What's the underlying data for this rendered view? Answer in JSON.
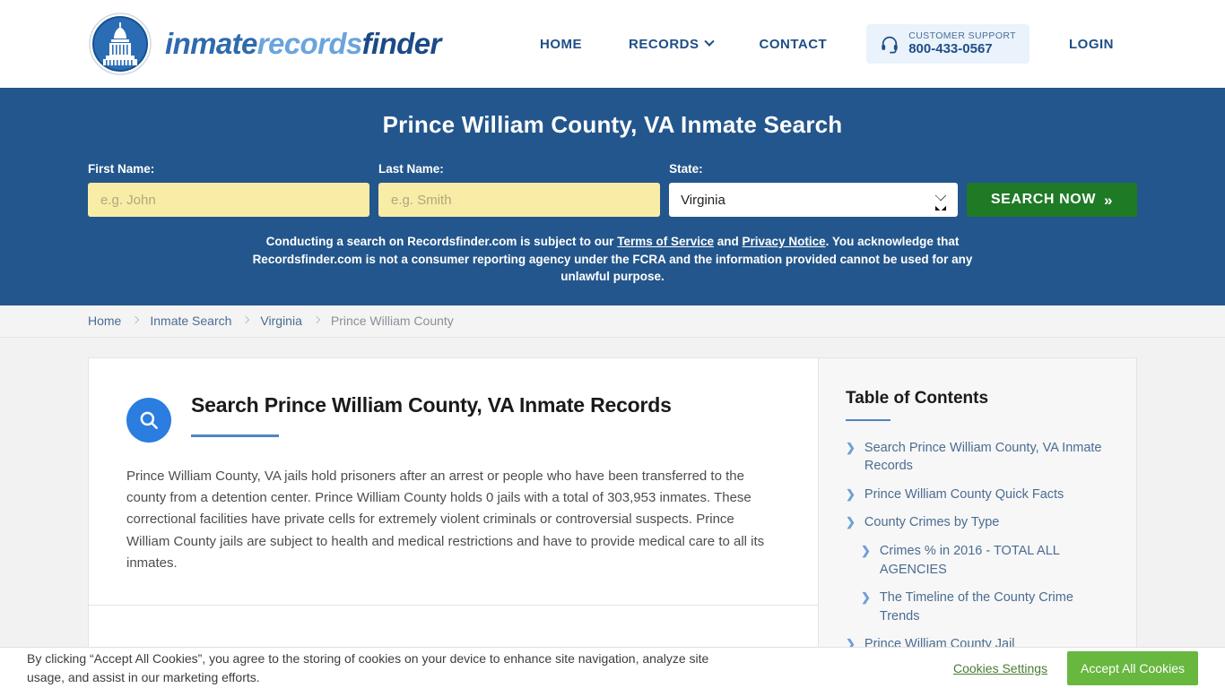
{
  "header": {
    "logo_alt": "capitol-dome-logo",
    "brand": {
      "part1": "inmate",
      "part2": "records",
      "part3": "finder"
    },
    "nav": [
      {
        "label": "HOME",
        "has_caret": false
      },
      {
        "label": "RECORDS",
        "has_caret": true
      },
      {
        "label": "CONTACT",
        "has_caret": false
      }
    ],
    "support": {
      "label": "CUSTOMER SUPPORT",
      "phone": "800-433-0567"
    },
    "login_label": "LOGIN"
  },
  "hero": {
    "title": "Prince William County, VA Inmate Search",
    "first_name_label": "First Name:",
    "first_name_placeholder": "e.g. John",
    "first_name_value": "",
    "last_name_label": "Last Name:",
    "last_name_placeholder": "e.g. Smith",
    "last_name_value": "",
    "state_label": "State:",
    "state_value": "Virginia",
    "state_options": [
      "Virginia"
    ],
    "search_button": "SEARCH NOW",
    "search_button_arrows": "»",
    "disclaimer": {
      "part1": "Conducting a search on Recordsfinder.com is subject to our ",
      "link1": "Terms of Service",
      "part2": " and ",
      "link2": "Privacy Notice",
      "part3": ". You acknowledge that Recordsfinder.com is not a consumer reporting agency under the FCRA and the information provided cannot be used for any unlawful purpose."
    }
  },
  "breadcrumb": [
    {
      "label": "Home",
      "current": false
    },
    {
      "label": "Inmate Search",
      "current": false
    },
    {
      "label": "Virginia",
      "current": false
    },
    {
      "label": "Prince William County",
      "current": true
    }
  ],
  "article": {
    "icon": "search-icon",
    "title": "Search Prince William County, VA Inmate Records",
    "body": "Prince William County, VA jails hold prisoners after an arrest or people who have been transferred to the county from a detention center. Prince William County holds 0 jails with a total of 303,953 inmates. These correctional facilities have private cells for extremely violent criminals or controversial suspects. Prince William County jails are subject to health and medical restrictions and have to provide medical care to all its inmates."
  },
  "toc": {
    "title": "Table of Contents",
    "items": [
      {
        "label": "Search Prince William County, VA Inmate Records",
        "sub": false
      },
      {
        "label": "Prince William County Quick Facts",
        "sub": false
      },
      {
        "label": "County Crimes by Type",
        "sub": false
      },
      {
        "label": "Crimes % in 2016 - TOTAL ALL AGENCIES",
        "sub": true
      },
      {
        "label": "The Timeline of the County Crime Trends",
        "sub": true
      },
      {
        "label": "Prince William County Jail",
        "sub": false
      }
    ]
  },
  "cookie": {
    "text": "By clicking “Accept All Cookies”, you agree to the storing of cookies on your device to enhance site navigation, analyze site usage, and assist in our marketing efforts.",
    "settings_label": "Cookies Settings",
    "accept_label": "Accept All Cookies"
  },
  "colors": {
    "hero_blue": "#23568c",
    "brand_dark": "#1c4a86",
    "brand_light": "#6aa4dd",
    "input_yellow": "#f9eca6",
    "search_green": "#1f7a25",
    "accent_blue": "#4d86c2",
    "cookie_green": "#68b73f"
  }
}
